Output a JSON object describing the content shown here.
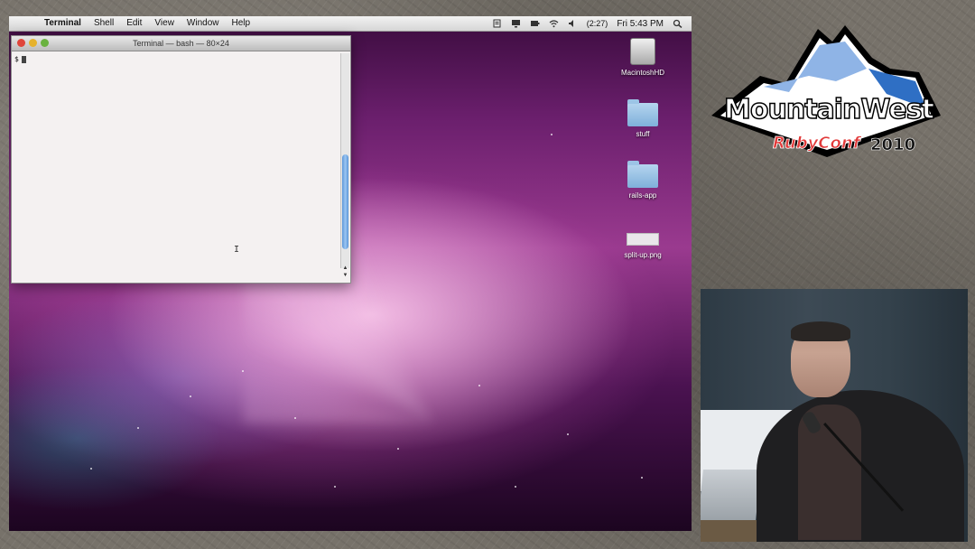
{
  "menubar": {
    "apple_symbol": "",
    "items": [
      "Terminal",
      "Shell",
      "Edit",
      "View",
      "Window",
      "Help"
    ],
    "battery": "(2:27)",
    "clock": "Fri 5:43 PM",
    "icons": [
      "script-icon",
      "display-icon",
      "battery-menu-icon",
      "wifi-icon",
      "volume-icon",
      "spotlight-search-icon"
    ]
  },
  "terminal": {
    "title": "Terminal — bash — 80×24",
    "prompt": "$"
  },
  "desktop_icons": [
    {
      "label": "MacintoshHD",
      "type": "drive"
    },
    {
      "label": "stuff",
      "type": "folder"
    },
    {
      "label": "rails-app",
      "type": "folder"
    },
    {
      "label": "split-up.png",
      "type": "image"
    }
  ],
  "logo": {
    "title": "MountainWest",
    "subtitle": "RubyConf",
    "year": "2010"
  },
  "colors": {
    "wallpaper": "#9a3a8f",
    "scroll_thumb": "#5a95d8",
    "logo_sub": "#e23a3a"
  }
}
